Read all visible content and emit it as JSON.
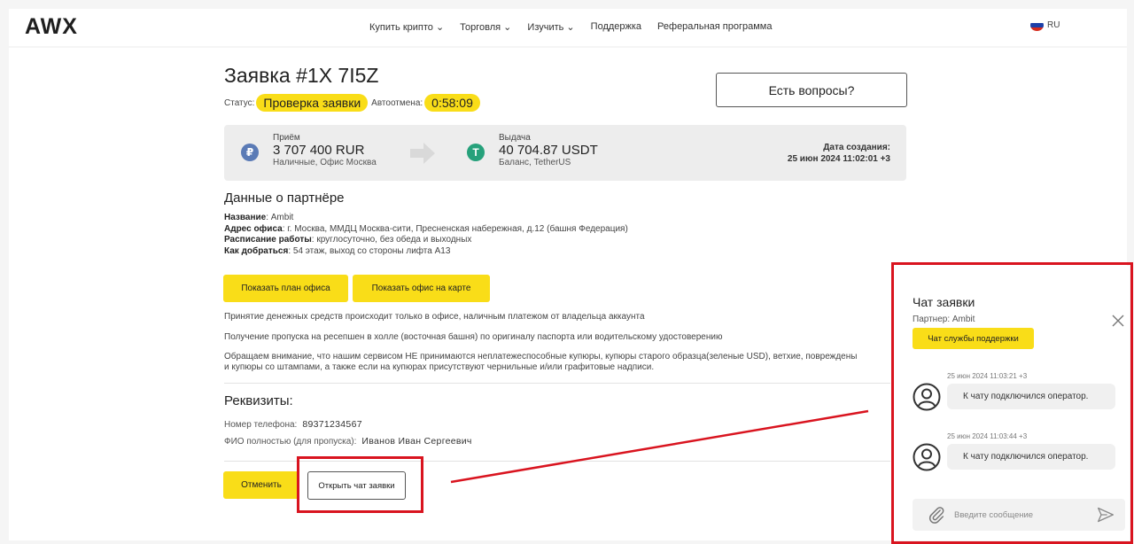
{
  "header": {
    "logo": "AWX",
    "nav": [
      "Купить крипто ⌄",
      "Торговля ⌄",
      "Изучить ⌄",
      "Поддержка",
      "Реферальная программа"
    ],
    "lang": "RU"
  },
  "order": {
    "title": "Заявка #1X       7I5Z",
    "status_label": "Статус:",
    "status_value": "Проверка заявки",
    "autocancel_label": "Автоотмена:",
    "autocancel_value": "0:58:09",
    "questions_button": "Есть вопросы?"
  },
  "exchange": {
    "receive_label": "Приём",
    "receive_amount": "3 707 400 RUR",
    "receive_method": "Наличные, Офис Москва",
    "receive_icon": "ruble-coin-icon",
    "give_label": "Выдача",
    "give_amount": "40 704.87 USDT",
    "give_method": "Баланс, TetherUS",
    "give_icon": "tether-coin-icon",
    "created_label": "Дата создания:",
    "created_value": "25 июн 2024 11:02:01 +3",
    "colors": {
      "ruble": "#5b7bb6",
      "tether": "#26a17b",
      "accent": "#f9dd18"
    }
  },
  "partner": {
    "heading": "Данные о партнёре",
    "fields": [
      {
        "label": "Название",
        "value": ": Ambit"
      },
      {
        "label": "Адрес офиса",
        "value": ": г. Москва, ММДЦ Москва-сити, Пресненская набережная, д.12 (башня Федерация)"
      },
      {
        "label": "Расписание работы",
        "value": ": круглосуточно, без обеда и выходных"
      },
      {
        "label": "Как добраться",
        "value": ": 54 этаж, выход со стороны лифта А13"
      }
    ],
    "btn_plan": "Показать план офиса",
    "btn_map": "Показать офис на карте"
  },
  "notes": [
    "Принятие денежных средств происходит только в офисе, наличным платежом от владельца аккаунта",
    "Получение пропуска на ресепшен в холле (восточная башня) по оригиналу паспорта или водительскому удостоверению",
    "Обращаем внимание, что нашим сервисом НЕ принимаются неплатежеспособные купюры, купюры старого образца(зеленые USD), ветхие, повреждены",
    "и купюры со штампами, а также если на купюрах присутствуют чернильные и/или графитовые надписи."
  ],
  "requisites": {
    "heading": "Реквизиты:",
    "phone_label": "Номер телефона:",
    "phone_value": "89371234567",
    "name_label": "ФИО полностью (для пропуска):",
    "name_value": "Иванов Иван Сергеевич"
  },
  "actions": {
    "cancel": "Отменить",
    "open_chat": "Открыть чат заявки"
  },
  "chat": {
    "title": "Чат заявки",
    "partner": "Партнер: Ambit",
    "support_button": "Чат службы поддержки",
    "messages": [
      {
        "time": "25 июн 2024 11:03:21 +3",
        "text": "К чату подключился оператор."
      },
      {
        "time": "25 июн 2024 11:03:44 +3",
        "text": "К чату подключился оператор."
      }
    ],
    "input_placeholder": "Введите сообщение"
  }
}
